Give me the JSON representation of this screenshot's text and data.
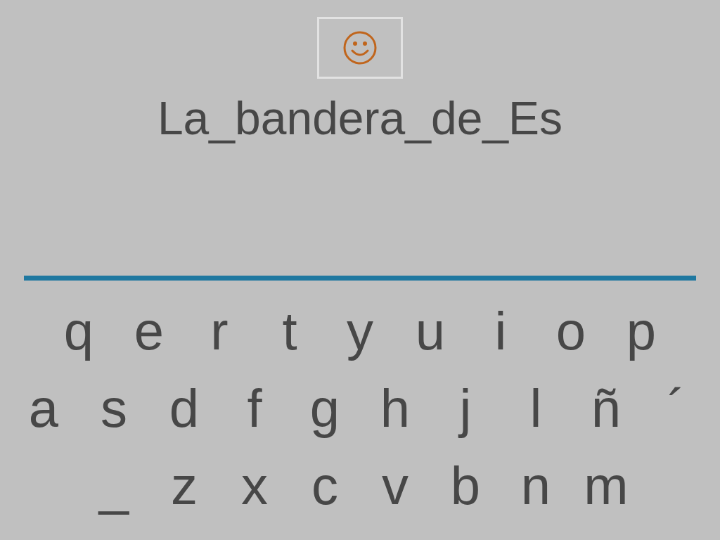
{
  "answer": {
    "text": "La_bandera_de_Es"
  },
  "keyboard": {
    "rows": [
      [
        "q",
        "e",
        "r",
        "t",
        "y",
        "u",
        "i",
        "o",
        "p"
      ],
      [
        "a",
        "s",
        "d",
        "f",
        "g",
        "h",
        "j",
        "l",
        "ñ",
        "´"
      ],
      [
        "_",
        "z",
        "x",
        "c",
        "v",
        "b",
        "n",
        "m"
      ]
    ]
  }
}
